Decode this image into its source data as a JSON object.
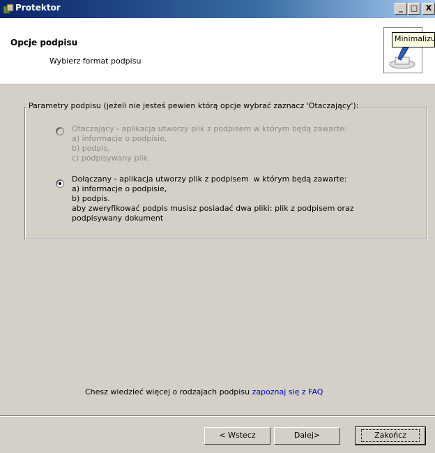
{
  "window": {
    "title": "Protektor",
    "min_symbol": "_",
    "max_symbol": "□",
    "close_symbol": "X"
  },
  "header": {
    "title": "Opcje podpisu",
    "subtitle": "Wybierz format podpisu",
    "tooltip": "Minimalizuj"
  },
  "group": {
    "legend": "Parametry podpisu (jeżeli nie jesteś pewien którą opcje wybrać zaznacz 'Otaczający'):",
    "options": [
      {
        "label": "Otaczający - aplikacja utworzy plik z podpisem w którym będą zawarte:\na) informacje o podpisie,\nb) podpis,\nc) podpisywany plik.",
        "selected": false,
        "enabled": false
      },
      {
        "label": "Dołączany - aplikacja utworzy plik z podpisem  w którym będą zawarte:\na) informacje o podpisie,\nb) podpis.\naby zweryfikować podpis musisz posiadać dwa pliki: plik z podpisem oraz\npodpisywany dokument",
        "selected": true,
        "enabled": true
      }
    ]
  },
  "faq": {
    "text": "Chesz wiedzieć więcej o rodzajach podpisu ",
    "link": "zapoznaj się z FAQ"
  },
  "buttons": {
    "back": "< Wstecz",
    "next": "Dalej>",
    "finish": "Zakończ"
  },
  "colors": {
    "dialog_bg": "#d4d0c8",
    "title_start": "#0a246a",
    "title_end": "#a6caf0",
    "link": "#0000cc"
  }
}
